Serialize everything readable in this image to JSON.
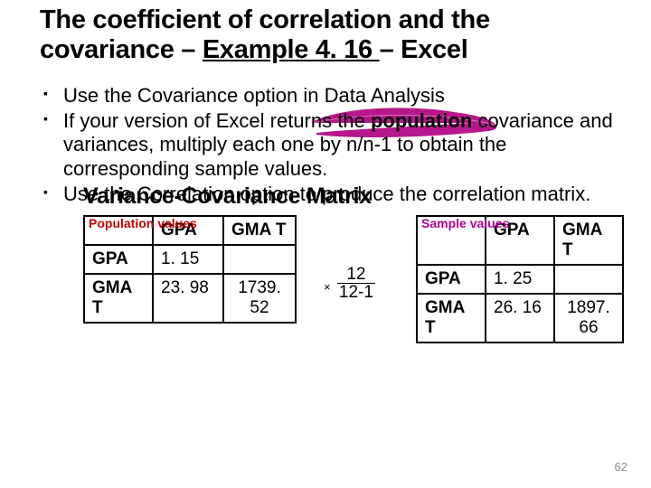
{
  "title_parts": {
    "a": "The coefficient of correlation and the covariance – ",
    "b": "Example 4. 16 ",
    "c": "– Excel"
  },
  "bullets": {
    "b1": "Use the Covariance option in Data Analysis",
    "b2a": "If your version of Excel returns the ",
    "b2b": "population",
    "b2c": " covariance and variances, multiply each one by n/n-1 to obtain the corresponding sample values.",
    "b3": "Use the Correlation option to produce the correlation matrix."
  },
  "matrix_heading": "Variance-Covariance Matrix",
  "pop_label": "Population values",
  "samp_label": "Sample values",
  "headers": {
    "gpa": "GPA",
    "gmat": "GMA T"
  },
  "rows": {
    "gpa": "GPA",
    "gmat": "GMA T"
  },
  "pop": {
    "gpa_gpa": "1. 15",
    "gmat_gpa": "23. 98",
    "gmat_gmat": "1739. 52"
  },
  "samp": {
    "gpa_gpa": "1. 25",
    "gmat_gpa": "26. 16",
    "gmat_gmat": "1897. 66"
  },
  "frac": {
    "times": "×",
    "num": "12",
    "den": "12-1"
  },
  "pagenum": "62",
  "chart_data": [
    {
      "type": "table",
      "title": "Population values",
      "columns": [
        "",
        "GPA",
        "GMAT"
      ],
      "rows": [
        [
          "GPA",
          1.15,
          null
        ],
        [
          "GMAT",
          23.98,
          1739.52
        ]
      ]
    },
    {
      "type": "table",
      "title": "Sample values",
      "columns": [
        "",
        "GPA",
        "GMAT"
      ],
      "rows": [
        [
          "GPA",
          1.25,
          null
        ],
        [
          "GMAT",
          26.16,
          1897.66
        ]
      ]
    }
  ]
}
